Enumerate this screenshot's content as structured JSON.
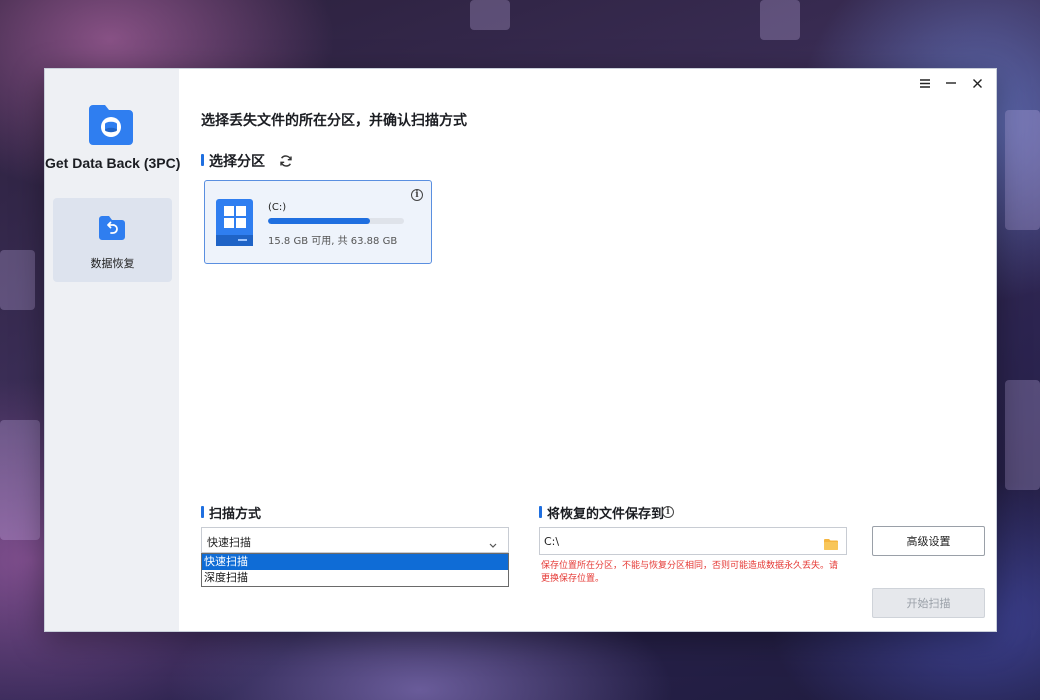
{
  "app": {
    "name": "Get Data Back (3PC)"
  },
  "sidebar": {
    "items": [
      {
        "label": "数据恢复",
        "active": true
      }
    ]
  },
  "window_controls": {
    "menu_icon": "menu-icon",
    "minimize_icon": "minimize-icon",
    "close_icon": "close-icon"
  },
  "main": {
    "title": "选择丢失文件的所在分区，并确认扫描方式",
    "partition_section": {
      "title": "选择分区",
      "partitions": [
        {
          "name": "(C:)",
          "size_text": "15.8 GB 可用, 共 63.88 GB",
          "used_fraction": 0.75,
          "selected": true
        }
      ]
    },
    "scan_mode": {
      "title": "扫描方式",
      "selected": "快速扫描",
      "options": [
        "快速扫描",
        "深度扫描"
      ]
    },
    "save_location": {
      "title": "将恢复的文件保存到",
      "path": "C:\\",
      "warning": "保存位置所在分区，不能与恢复分区相同，否则可能造成数据永久丢失。请更换保存位置。"
    },
    "buttons": {
      "advanced": "高级设置",
      "start": "开始扫描"
    }
  },
  "colors": {
    "accent": "#1f6fe0",
    "warning": "#e53935",
    "sidebar_bg": "#eef0f4",
    "selected_card_bg": "#eef3fb"
  }
}
